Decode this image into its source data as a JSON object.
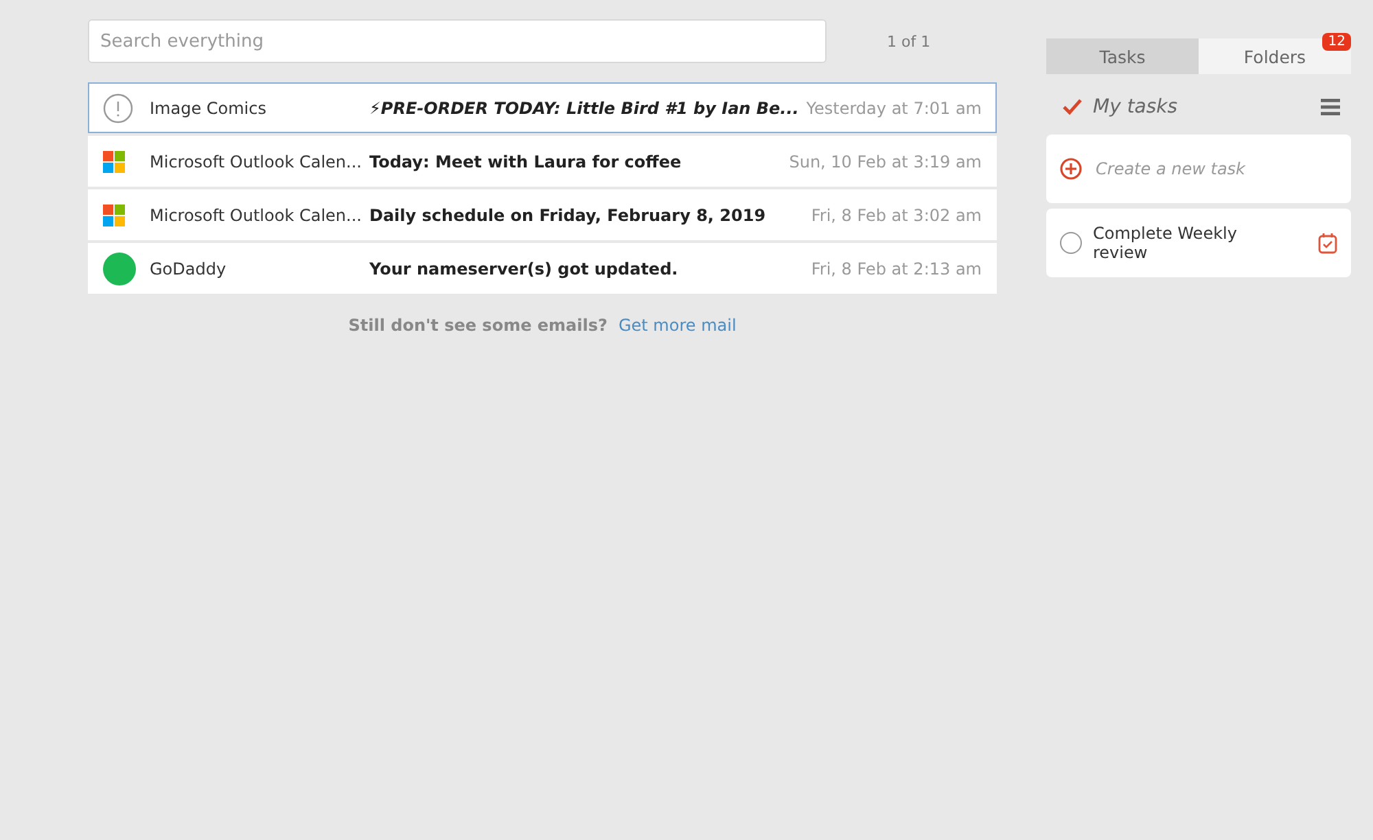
{
  "search": {
    "placeholder": "Search everything"
  },
  "pager": "1 of 1",
  "emails": [
    {
      "kind": "alert",
      "sender": "Image Comics",
      "subject": "⚡PRE-ORDER TODAY: Little Bird #1 by Ian Be...",
      "italic": true,
      "time": "Yesterday at 7:01 am",
      "selected": true
    },
    {
      "kind": "windows",
      "sender": "Microsoft Outlook Calen...",
      "subject": "Today: Meet with Laura for coffee",
      "italic": false,
      "time": "Sun, 10 Feb at 3:19 am",
      "selected": false
    },
    {
      "kind": "windows",
      "sender": "Microsoft Outlook Calen...",
      "subject": "Daily schedule on Friday, February 8, 2019",
      "italic": false,
      "time": "Fri, 8 Feb at 3:02 am",
      "selected": false
    },
    {
      "kind": "circle",
      "color": "#1db954",
      "sender": "GoDaddy",
      "subject": "Your nameserver(s) got updated.",
      "italic": false,
      "time": "Fri, 8 Feb at 2:13 am",
      "selected": false
    }
  ],
  "more": {
    "text": "Still don't see some emails?",
    "link": "Get more mail"
  },
  "tabs": [
    {
      "label": "Tasks",
      "selected": true
    },
    {
      "label": "Folders",
      "selected": false,
      "badge": "12"
    }
  ],
  "task_list": {
    "title": "My tasks",
    "new_task_placeholder": "Create a new task"
  },
  "tasks": [
    {
      "title": "Complete Weekly review",
      "checked": false
    }
  ]
}
